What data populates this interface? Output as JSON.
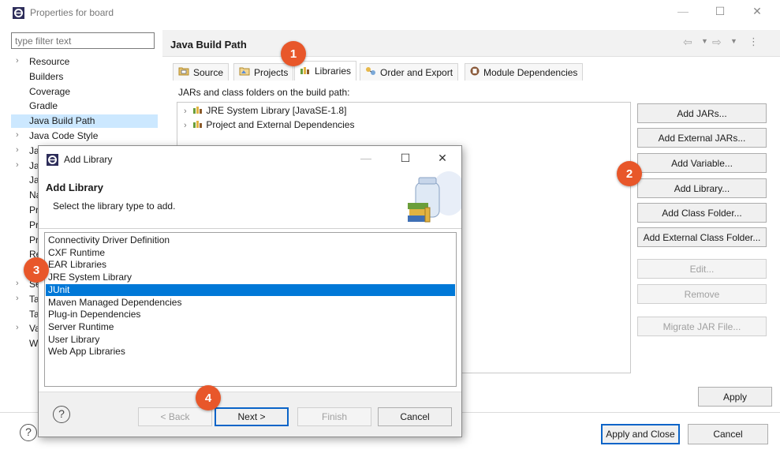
{
  "window": {
    "title": "Properties for board",
    "controls": {
      "minimize": "—",
      "maximize": "☐",
      "close": "✕"
    }
  },
  "sidebar": {
    "filter_placeholder": "type filter text",
    "items": [
      {
        "label": "Resource",
        "expandable": true
      },
      {
        "label": "Builders",
        "expandable": false
      },
      {
        "label": "Coverage",
        "expandable": false
      },
      {
        "label": "Gradle",
        "expandable": false
      },
      {
        "label": "Java Build Path",
        "expandable": false,
        "selected": true
      },
      {
        "label": "Java Code Style",
        "expandable": true
      },
      {
        "label": "Ja",
        "expandable": true
      },
      {
        "label": "Ja",
        "expandable": true
      },
      {
        "label": "Ja",
        "expandable": false
      },
      {
        "label": "Na",
        "expandable": false
      },
      {
        "label": "Pr",
        "expandable": false
      },
      {
        "label": "Pr",
        "expandable": false
      },
      {
        "label": "Pr",
        "expandable": false
      },
      {
        "label": "Re",
        "expandable": false
      },
      {
        "label": "Ru",
        "expandable": false
      },
      {
        "label": "Se",
        "expandable": true
      },
      {
        "label": "Ta",
        "expandable": true
      },
      {
        "label": "Ta",
        "expandable": false
      },
      {
        "label": "Va",
        "expandable": true
      },
      {
        "label": "W",
        "expandable": false
      }
    ]
  },
  "main": {
    "title": "Java Build Path",
    "tabs": [
      "Source",
      "Projects",
      "Libraries",
      "Order and Export",
      "Module Dependencies"
    ],
    "active_tab": "Libraries",
    "section_label": "JARs and class folders on the build path:",
    "tree": [
      "JRE System Library [JavaSE-1.8]",
      "Project and External Dependencies"
    ],
    "buttons": {
      "add_jars": "Add JARs...",
      "add_external_jars": "Add External JARs...",
      "add_variable": "Add Variable...",
      "add_library": "Add Library...",
      "add_class_folder": "Add Class Folder...",
      "add_external_class_folder": "Add External Class Folder...",
      "edit": "Edit...",
      "remove": "Remove",
      "migrate_jar": "Migrate JAR File..."
    },
    "apply": "Apply"
  },
  "footer": {
    "help": "?",
    "apply_and_close": "Apply and Close",
    "cancel": "Cancel"
  },
  "dialog": {
    "window_title": "Add Library",
    "controls": {
      "minimize": "—",
      "maximize": "☐",
      "close": "✕"
    },
    "heading": "Add Library",
    "description": "Select the library type to add.",
    "list": [
      "Connectivity Driver Definition",
      "CXF Runtime",
      "EAR Libraries",
      "JRE System Library",
      "JUnit",
      "Maven Managed Dependencies",
      "Plug-in Dependencies",
      "Server Runtime",
      "User Library",
      "Web App Libraries"
    ],
    "selected": "JUnit",
    "help": "?",
    "back": "< Back",
    "next": "Next >",
    "finish": "Finish",
    "cancel": "Cancel"
  },
  "badges": [
    "1",
    "2",
    "3",
    "4"
  ],
  "colors": {
    "badge": "#e8572a",
    "selection": "#0078d7",
    "sidebar_selection": "#cce8ff",
    "default_button_border": "#0a64c8"
  }
}
